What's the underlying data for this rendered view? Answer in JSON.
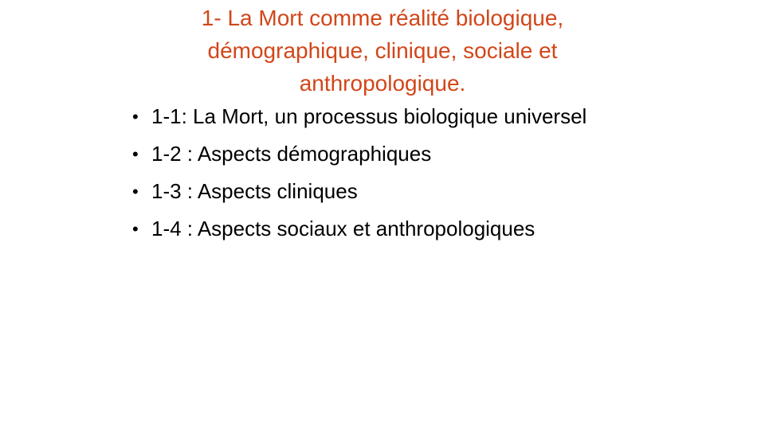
{
  "slide": {
    "title_lines": [
      "1- La Mort comme réalité biologique,",
      "démographique, clinique, sociale et",
      "anthropologique."
    ],
    "bullet_symbol": "•",
    "bullets": [
      "1-1: La Mort, un processus biologique universel",
      "1-2 : Aspects démographiques",
      "1-3 : Aspects cliniques",
      "1-4 : Aspects sociaux et anthropologiques"
    ],
    "colors": {
      "title": "#d24619",
      "body": "#000000",
      "background": "#ffffff"
    }
  }
}
